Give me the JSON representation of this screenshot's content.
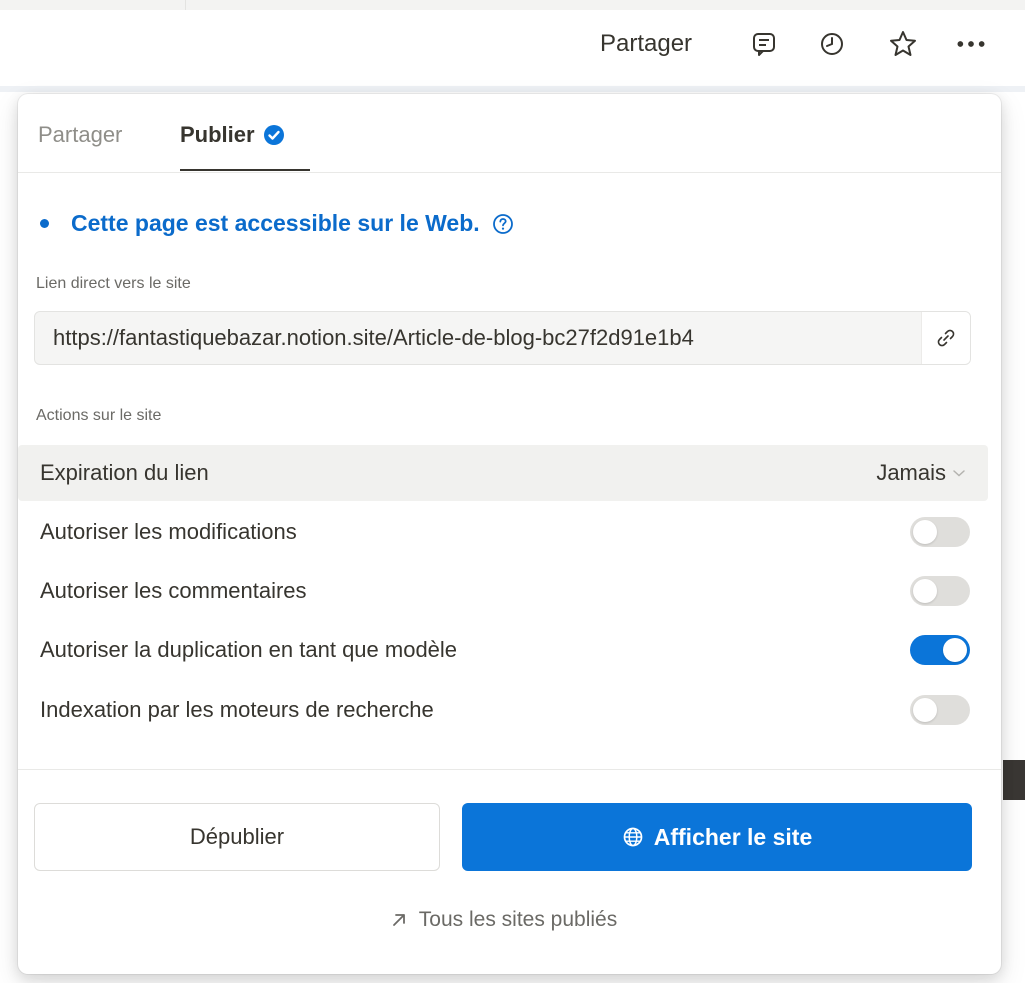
{
  "topbar": {
    "share_label": "Partager",
    "icons": [
      "comment-icon",
      "history-clock-icon",
      "star-icon",
      "more-dots-icon"
    ]
  },
  "popover": {
    "tabs": [
      {
        "label": "Partager",
        "active": false
      },
      {
        "label": "Publier",
        "active": true,
        "badge_icon": "verified-check-icon"
      }
    ],
    "status_text": "Cette page est accessible sur le Web.",
    "direct_link_label": "Lien direct vers le site",
    "direct_link_value": "https://fantastiquebazar.notion.site/Article-de-blog-bc27f2d91e1b4",
    "actions_label": "Actions sur le site",
    "expiration": {
      "label": "Expiration du lien",
      "value": "Jamais"
    },
    "toggles": [
      {
        "label": "Autoriser les modifications",
        "on": false
      },
      {
        "label": "Autoriser les commentaires",
        "on": false
      },
      {
        "label": "Autoriser la duplication en tant que modèle",
        "on": true
      },
      {
        "label": "Indexation par les moteurs de recherche",
        "on": false
      }
    ],
    "unpublish_label": "Dépublier",
    "view_site_label": "Afficher le site",
    "all_sites_label": "Tous les sites publiés"
  },
  "colors": {
    "accent": "#0b75d9",
    "link_blue": "#0b6bcb",
    "text": "#37352f",
    "muted": "#6b6a66",
    "toggle_off": "#dfdedb"
  }
}
